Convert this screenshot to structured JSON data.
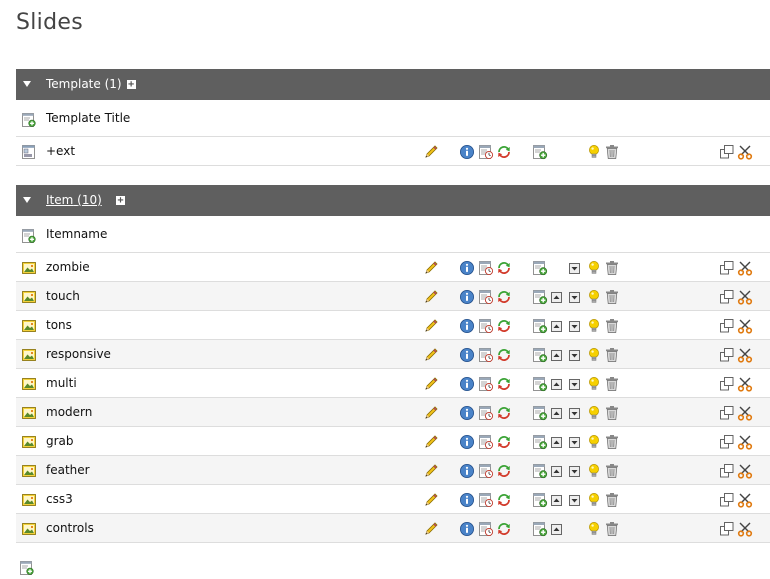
{
  "page": {
    "title": "Slides"
  },
  "template_section": {
    "title_prefix": "Template",
    "count": "(1)",
    "new_record_label": "Template Title",
    "records": [
      {
        "label": "+ext"
      }
    ]
  },
  "item_section": {
    "title_prefix": "Item",
    "count": "(10)",
    "new_record_label": "Itemname",
    "records": [
      {
        "label": "zombie",
        "move_up": false,
        "move_down": true
      },
      {
        "label": "touch",
        "move_up": true,
        "move_down": true
      },
      {
        "label": "tons",
        "move_up": true,
        "move_down": true
      },
      {
        "label": "responsive",
        "move_up": true,
        "move_down": true
      },
      {
        "label": "multi",
        "move_up": true,
        "move_down": true
      },
      {
        "label": "modern",
        "move_up": true,
        "move_down": true
      },
      {
        "label": "grab",
        "move_up": true,
        "move_down": true
      },
      {
        "label": "feather",
        "move_up": true,
        "move_down": true
      },
      {
        "label": "css3",
        "move_up": true,
        "move_down": true
      },
      {
        "label": "controls",
        "move_up": true,
        "move_down": false
      }
    ]
  },
  "icons": {
    "row_actions": [
      "edit-pencil-icon",
      "info-icon",
      "history-icon",
      "refresh-icon",
      "new-after-icon",
      "move-up-icon",
      "move-down-icon",
      "hide-lightbulb-icon",
      "delete-trash-icon",
      "copy-icon",
      "cut-scissors-icon"
    ]
  },
  "colors": {
    "header_bg": "#5f5f5f",
    "alt_row_bg": "#f5f5f5",
    "info_blue": "#2f6db5",
    "refresh_green": "#3aa335",
    "refresh_red": "#d23a2a",
    "pencil_yellow": "#f2c21a",
    "bulb_yellow": "#f6d000",
    "scissors_orange": "#e07a10"
  }
}
